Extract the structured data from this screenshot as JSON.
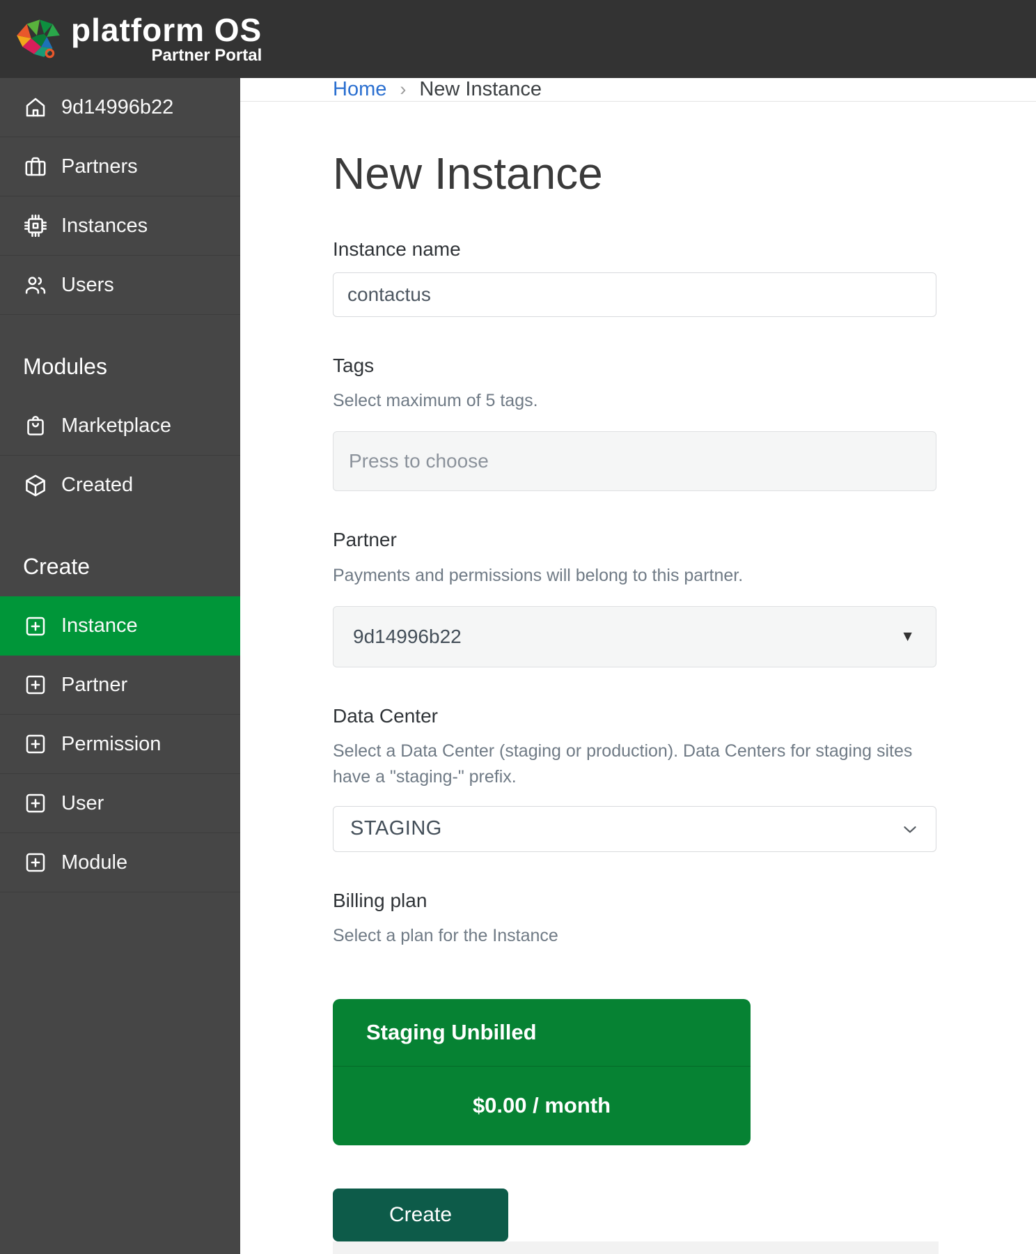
{
  "header": {
    "brand": "platform OS",
    "subtitle": "Partner Portal"
  },
  "sidebar": {
    "nav": [
      {
        "label": "9d14996b22",
        "icon": "home-icon"
      },
      {
        "label": "Partners",
        "icon": "briefcase-icon"
      },
      {
        "label": "Instances",
        "icon": "chip-icon"
      },
      {
        "label": "Users",
        "icon": "users-icon"
      }
    ],
    "sections": {
      "modules": {
        "title": "Modules",
        "items": [
          {
            "label": "Marketplace",
            "icon": "shopping-bag-icon"
          },
          {
            "label": "Created",
            "icon": "cube-icon"
          }
        ]
      },
      "create": {
        "title": "Create",
        "items": [
          {
            "label": "Instance",
            "icon": "plus-square-icon",
            "active": true
          },
          {
            "label": "Partner",
            "icon": "plus-square-icon"
          },
          {
            "label": "Permission",
            "icon": "plus-square-icon"
          },
          {
            "label": "User",
            "icon": "plus-square-icon"
          },
          {
            "label": "Module",
            "icon": "plus-square-icon"
          }
        ]
      }
    }
  },
  "breadcrumb": {
    "home": "Home",
    "separator": "›",
    "current": "New Instance"
  },
  "form": {
    "title": "New Instance",
    "instance_name": {
      "label": "Instance name",
      "value": "contactus"
    },
    "tags": {
      "label": "Tags",
      "hint": "Select maximum of 5 tags.",
      "placeholder": "Press to choose"
    },
    "partner": {
      "label": "Partner",
      "hint": "Payments and permissions will belong to this partner.",
      "selected": "9d14996b22",
      "caret": "▼"
    },
    "data_center": {
      "label": "Data Center",
      "hint": "Select a Data Center (staging or production). Data Centers for staging sites have a \"staging-\" prefix.",
      "selected": "STAGING"
    },
    "billing": {
      "label": "Billing plan",
      "hint": "Select a plan for the Instance",
      "plan": {
        "name": "Staging Unbilled",
        "price": "$0.00 / month"
      }
    },
    "submit": "Create"
  },
  "colors": {
    "header_bg": "#333333",
    "sidebar_bg": "#464646",
    "sidebar_active": "#009639",
    "link_blue": "#2a6fd0",
    "plan_card_green": "#068233",
    "create_button_green": "#0d5b49"
  }
}
